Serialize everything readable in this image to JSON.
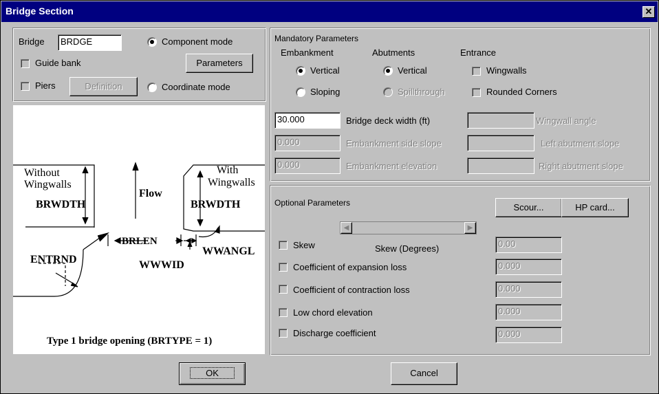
{
  "window": {
    "title": "Bridge Section",
    "close_glyph": "✕"
  },
  "top_left": {
    "bridge_label": "Bridge",
    "bridge_value": "BRDGE",
    "component_mode": "Component mode",
    "coordinate_mode": "Coordinate mode",
    "guide_bank": "Guide bank",
    "piers": "Piers",
    "parameters_button": "Parameters",
    "definition_button": "Definition",
    "component_selected": true
  },
  "diagram": {
    "without_wingwalls_1": "Without",
    "without_wingwalls_2": "Wingwalls",
    "with_1": "With",
    "with_2": "Wingwalls",
    "brwdth_left": "BRWDTH",
    "brwdth_right": "BRWDTH",
    "flow": "Flow",
    "brlen": "BRLEN",
    "wwangl": "WWANGL",
    "entrnd": "ENTRND",
    "wwwid": "WWWID",
    "caption": "Type 1 bridge opening (BRTYPE = 1)"
  },
  "mandatory": {
    "title": "Mandatory Parameters",
    "embankment": "Embankment",
    "abutments": "Abutments",
    "entrance": "Entrance",
    "emb_vertical": "Vertical",
    "emb_sloping": "Sloping",
    "abut_vertical": "Vertical",
    "abut_spill": "Spillthrough",
    "wingwalls": "Wingwalls",
    "rounded": "Rounded Corners",
    "deck_width_value": "30.000",
    "deck_width_label": "Bridge deck width (ft)",
    "emb_side_value": "0.000",
    "emb_side_label": "Embankment side slope",
    "emb_elev_value": "0.000",
    "emb_elev_label": "Embankment elevation",
    "wingwall_angle_label": "Wingwall angle",
    "left_abut_label": "Left abutment slope",
    "right_abut_label": "Right abutment slope"
  },
  "optional": {
    "title": "Optional Parameters",
    "scour_button": "Scour...",
    "hp_button": "HP card...",
    "skew": "Skew",
    "skew_degrees": "Skew (Degrees)",
    "skew_value": "0.00",
    "expansion": "Coefficient of expansion loss",
    "expansion_value": "0.000",
    "contraction": "Coefficient of contraction loss",
    "contraction_value": "0.000",
    "low_chord": "Low chord elevation",
    "low_chord_value": "0.000",
    "discharge": "Discharge coefficient",
    "discharge_value": "0.000"
  },
  "buttons": {
    "ok": "OK",
    "cancel": "Cancel"
  }
}
